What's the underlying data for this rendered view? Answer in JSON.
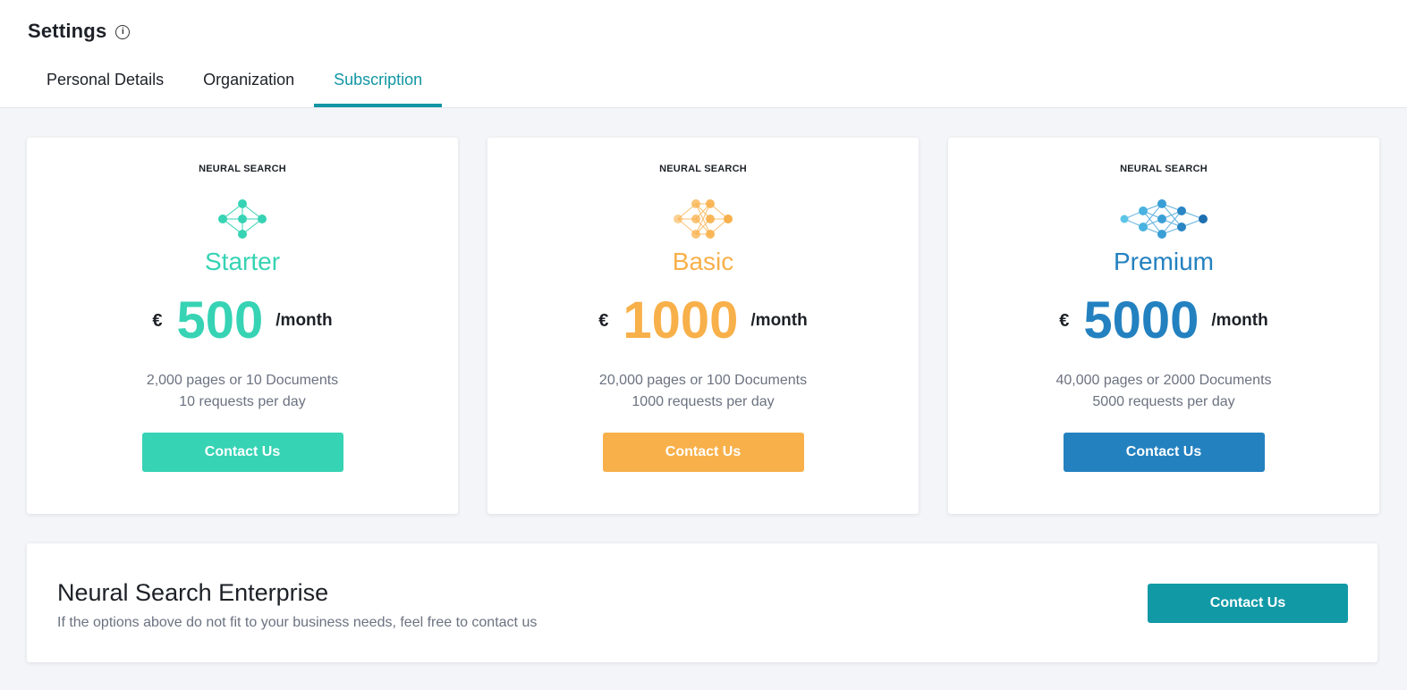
{
  "header": {
    "title": "Settings",
    "info_glyph": "i"
  },
  "tabs": [
    {
      "label": "Personal Details",
      "active": false
    },
    {
      "label": "Organization",
      "active": false
    },
    {
      "label": "Subscription",
      "active": true
    }
  ],
  "colors": {
    "starter": "#36d3b4",
    "basic": "#f8b04a",
    "premium": "#2381c0",
    "enterprise": "#1299a6",
    "active_tab": "#1296a3"
  },
  "plans": [
    {
      "label": "NEURAL SEARCH",
      "icon": "neural-network-small-icon",
      "name": "Starter",
      "currency": "€",
      "amount": "500",
      "period": "/month",
      "desc_line1": "2,000 pages or 10 Documents",
      "desc_line2": "10 requests per day",
      "button_label": "Contact Us"
    },
    {
      "label": "NEURAL SEARCH",
      "icon": "neural-network-medium-icon",
      "name": "Basic",
      "currency": "€",
      "amount": "1000",
      "period": "/month",
      "desc_line1": "20,000 pages or 100 Documents",
      "desc_line2": "1000 requests per day",
      "button_label": "Contact Us"
    },
    {
      "label": "NEURAL SEARCH",
      "icon": "neural-network-large-icon",
      "name": "Premium",
      "currency": "€",
      "amount": "5000",
      "period": "/month",
      "desc_line1": "40,000 pages or 2000 Documents",
      "desc_line2": "5000 requests per day",
      "button_label": "Contact Us"
    }
  ],
  "enterprise": {
    "title": "Neural Search Enterprise",
    "description": "If the options above do not fit to your business needs, feel free to contact us",
    "button_label": "Contact Us"
  }
}
